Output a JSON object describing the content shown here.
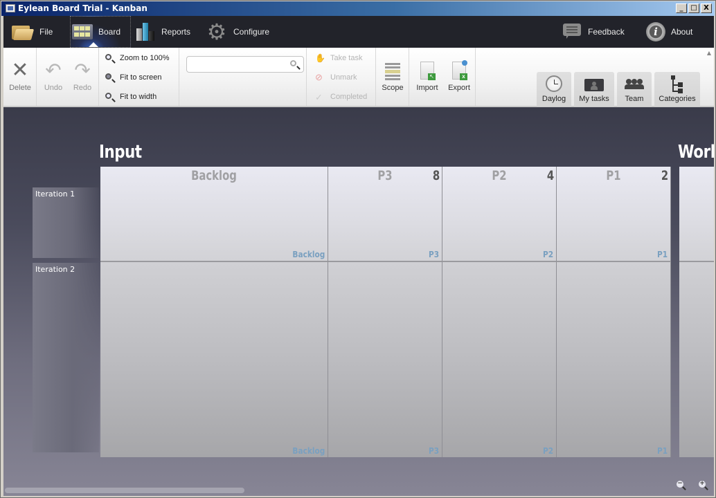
{
  "window": {
    "title": "Eylean Board Trial - Kanban",
    "controls": {
      "minimize": "_",
      "maximize": "□",
      "close": "X"
    }
  },
  "mainnav": {
    "items": [
      {
        "label": "File",
        "icon": "folder-icon"
      },
      {
        "label": "Board",
        "icon": "board-icon",
        "active": true
      },
      {
        "label": "Reports",
        "icon": "bar-chart-icon"
      },
      {
        "label": "Configure",
        "icon": "gear-icon"
      }
    ],
    "right": [
      {
        "label": "Feedback",
        "icon": "speech-bubble-icon"
      },
      {
        "label": "About",
        "icon": "info-icon"
      }
    ]
  },
  "ribbon": {
    "edit": {
      "delete": "Delete",
      "undo": "Undo",
      "redo": "Redo"
    },
    "zoom": {
      "zoom100": "Zoom to 100%",
      "fit_screen": "Fit to screen",
      "fit_width": "Fit to width"
    },
    "search": {
      "value": "",
      "placeholder": ""
    },
    "task": {
      "take": "Take task",
      "unmark": "Unmark",
      "completed": "Completed"
    },
    "scope": "Scope",
    "import": "Import",
    "export": "Export",
    "views": {
      "daylog": "Daylog",
      "mytasks": "My tasks",
      "team": "Team",
      "categories": "Categories"
    }
  },
  "board": {
    "sections": [
      {
        "title": "Input"
      },
      {
        "title": "Work"
      }
    ],
    "iterations": [
      "Iteration 1",
      "Iteration 2"
    ],
    "columns": [
      {
        "name": "Backlog",
        "limit": "",
        "tag": "Backlog"
      },
      {
        "name": "P3",
        "limit": "8",
        "tag": "P3"
      },
      {
        "name": "P2",
        "limit": "4",
        "tag": "P2"
      },
      {
        "name": "P1",
        "limit": "2",
        "tag": "P1"
      }
    ],
    "zoom_out": "−",
    "zoom_in": "+"
  }
}
